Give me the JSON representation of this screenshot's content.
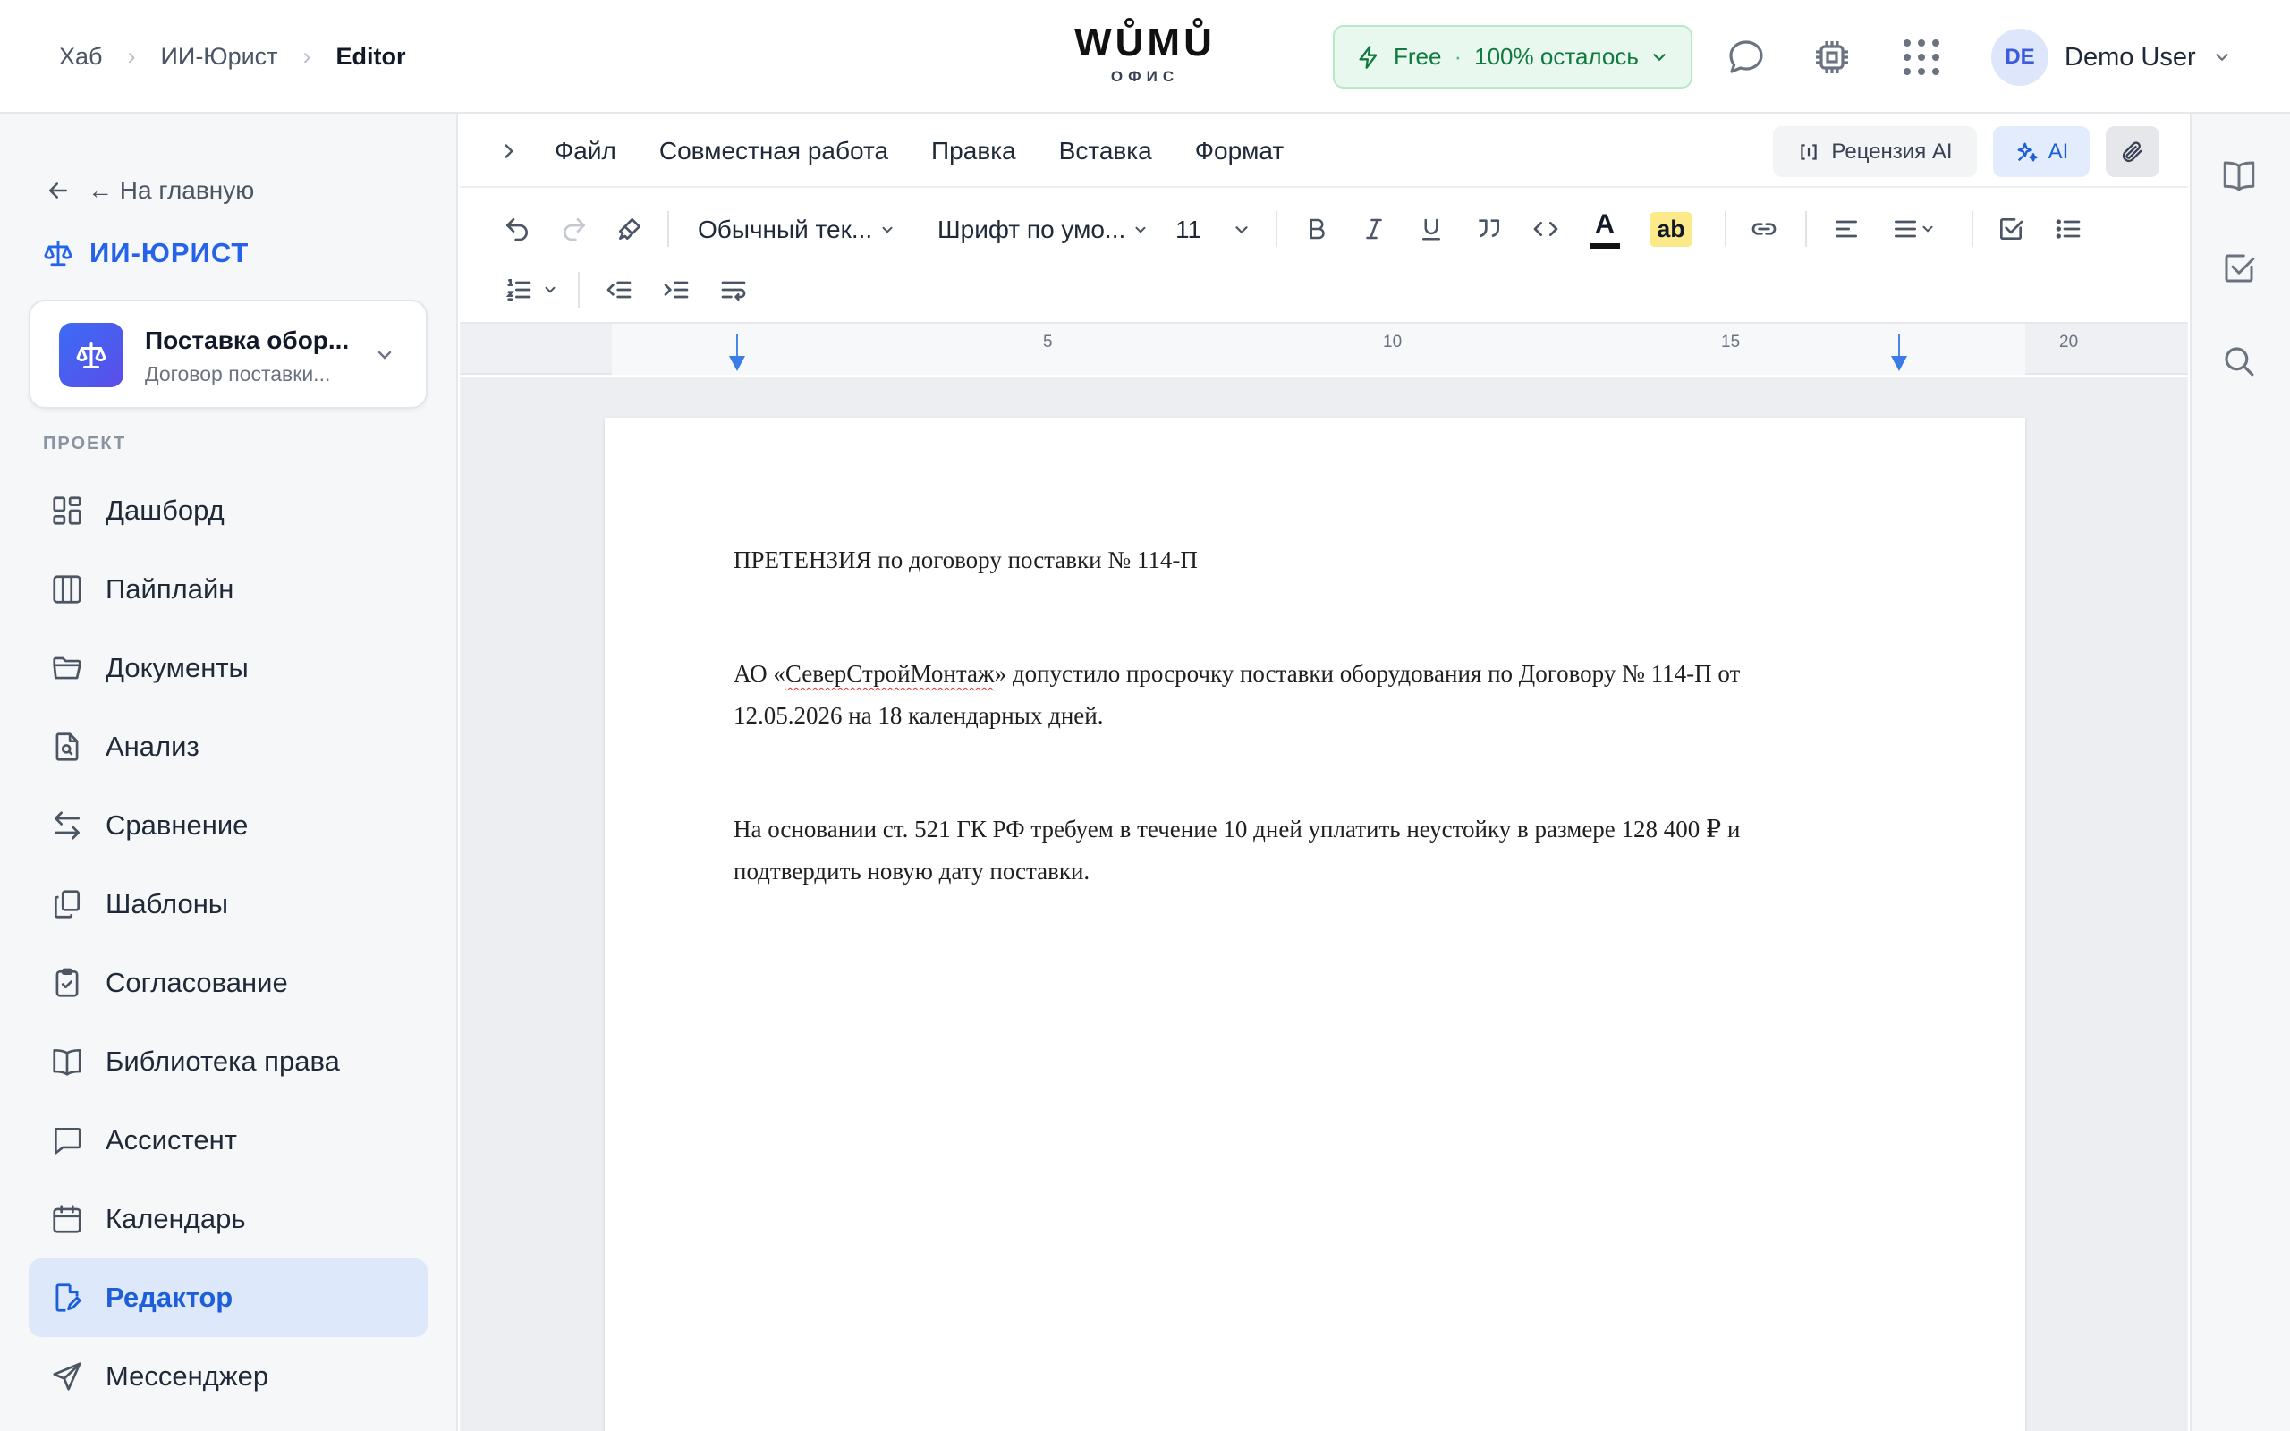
{
  "header": {
    "breadcrumbs": [
      "Хаб",
      "ИИ-Юрист",
      "Editor"
    ],
    "logo_word": "WŮMŮ",
    "logo_sub": "ОФИС",
    "plan": {
      "name": "Free",
      "status": "100% осталось",
      "color": "#0f7a3d"
    },
    "icons": [
      "chat-icon",
      "chip-icon",
      "apps-grid-icon"
    ],
    "user": {
      "initials": "DE",
      "name": "Demo User"
    }
  },
  "sidebar": {
    "back_label": "← На главную",
    "app_title": "ИИ-ЮРИСТ",
    "project": {
      "title": "Поставка обор...",
      "subtitle": "Договор поставки..."
    },
    "section_label": "ПРОЕКТ",
    "items": [
      {
        "label": "Дашборд",
        "icon": "dashboard-icon"
      },
      {
        "label": "Пайплайн",
        "icon": "columns-icon"
      },
      {
        "label": "Документы",
        "icon": "folder-icon"
      },
      {
        "label": "Анализ",
        "icon": "file-search-icon"
      },
      {
        "label": "Сравнение",
        "icon": "compare-arrows-icon"
      },
      {
        "label": "Шаблоны",
        "icon": "templates-icon"
      },
      {
        "label": "Согласование",
        "icon": "clipboard-check-icon"
      },
      {
        "label": "Библиотека права",
        "icon": "book-icon"
      },
      {
        "label": "Ассистент",
        "icon": "message-icon"
      },
      {
        "label": "Календарь",
        "icon": "calendar-icon"
      },
      {
        "label": "Редактор",
        "icon": "edit-file-icon",
        "active": true
      },
      {
        "label": "Мессенджер",
        "icon": "send-icon"
      }
    ],
    "accent": "#1d5fd8"
  },
  "editor": {
    "menus": [
      "Файл",
      "Совместная работа",
      "Правка",
      "Вставка",
      "Формат"
    ],
    "review_label": "Рецензия AI",
    "ai_label": "AI",
    "toolbar": {
      "paragraph_style": "Обычный тек...",
      "font_family": "Шрифт по умо...",
      "font_size": "11",
      "highlight_label": "ab",
      "text_color_label": "A"
    },
    "ruler": {
      "labels": [
        "5",
        "10",
        "15",
        "20"
      ]
    },
    "document": {
      "title": "ПРЕТЕНЗИЯ по договору поставки № 114-П",
      "para1_before": "АО «",
      "para1_misspelled": "СеверСтройМонтаж",
      "para1_after": "» допустило просрочку поставки оборудования по Договору № 114-П от 12.05.2026 на 18 календарных дней.",
      "para2": "На основании ст. 521 ГК РФ требуем в течение 10 дней уплатить неустойку в размере 128 400 ₽ и подтвердить новую дату поставки."
    }
  },
  "right_rail": {
    "icons": [
      "book-icon",
      "checkbox-icon",
      "search-icon"
    ]
  }
}
